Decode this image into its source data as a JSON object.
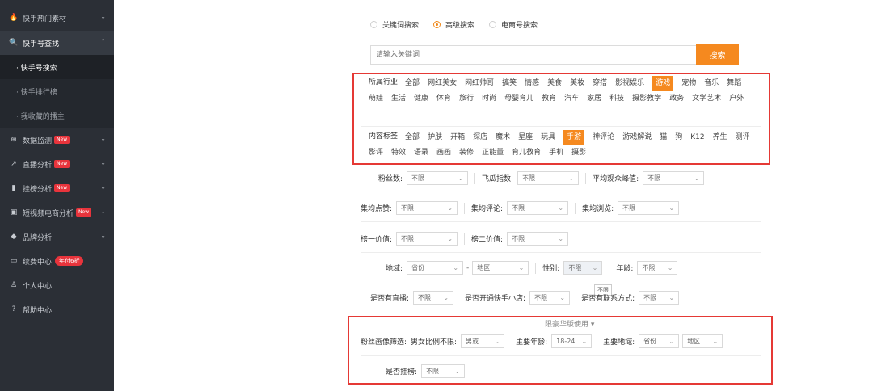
{
  "sidebar": {
    "items": [
      {
        "icon": "flame-icon",
        "glyph": "🔥",
        "label": "快手热门素材",
        "chev": "⌄"
      },
      {
        "icon": "search-icon",
        "glyph": "🔍",
        "label": "快手号查找",
        "chev": "⌃"
      },
      {
        "label": "· 快手号搜索"
      },
      {
        "label": "· 快手排行榜"
      },
      {
        "label": "· 我收藏的播主"
      },
      {
        "icon": "monitor-icon",
        "glyph": "⊕",
        "label": "数据监测",
        "badge": "New",
        "chev": "⌄"
      },
      {
        "icon": "live-chart-icon",
        "glyph": "↗",
        "label": "直播分析",
        "badge": "New",
        "chev": "⌄"
      },
      {
        "icon": "bar-chart-icon",
        "glyph": "▮",
        "label": "挂榜分析",
        "badge": "New",
        "chev": "⌄"
      },
      {
        "icon": "bag-icon",
        "glyph": "▣",
        "label": "短视频电商分析",
        "badge": "New",
        "chev": "⌄"
      },
      {
        "icon": "diamond-icon",
        "glyph": "◆",
        "label": "品牌分析",
        "chev": "⌄"
      },
      {
        "icon": "card-icon",
        "glyph": "▭",
        "label": "续费中心",
        "pill": "年付6折"
      },
      {
        "icon": "user-icon",
        "glyph": "♙",
        "label": "个人中心"
      },
      {
        "icon": "help-icon",
        "glyph": "?",
        "label": "帮助中心"
      }
    ]
  },
  "search": {
    "modes": [
      "关键词搜索",
      "高级搜索",
      "电商号搜索"
    ],
    "placeholder": "请输入关键词",
    "button": "搜索"
  },
  "industry": {
    "label": "所属行业:",
    "tags": [
      "全部",
      "网红美女",
      "网红帅哥",
      "搞笑",
      "情感",
      "美食",
      "美妆",
      "穿搭",
      "影视娱乐",
      "游戏",
      "宠物",
      "音乐",
      "舞蹈",
      "萌娃",
      "生活",
      "健康",
      "体育",
      "旅行",
      "时尚",
      "母婴育儿",
      "教育",
      "汽车",
      "家居",
      "科技",
      "摄影教学",
      "政务",
      "文学艺术",
      "户外"
    ]
  },
  "content": {
    "label": "内容标签:",
    "tags": [
      "全部",
      "护肤",
      "开箱",
      "探店",
      "魔术",
      "星座",
      "玩具",
      "手游",
      "神评论",
      "游戏解说",
      "猫",
      "狗",
      "K12",
      "养生",
      "测评",
      "影评",
      "特效",
      "语录",
      "画画",
      "装修",
      "正能量",
      "育儿教育",
      "手机",
      "摄影"
    ]
  },
  "filters": {
    "fans": {
      "label": "粉丝数:",
      "value": "不限"
    },
    "feigua": {
      "label": "飞瓜指数:",
      "value": "不限"
    },
    "avg_peak": {
      "label": "平均观众峰值:",
      "value": "不限"
    },
    "avg_like": {
      "label": "集均点赞:",
      "value": "不限"
    },
    "avg_comment": {
      "label": "集均评论:",
      "value": "不限"
    },
    "avg_view": {
      "label": "集均浏览:",
      "value": "不限"
    },
    "rank1": {
      "label": "榜一价值:",
      "value": "不限"
    },
    "rank2": {
      "label": "榜二价值:",
      "value": "不限"
    },
    "region": {
      "label": "地域:",
      "province": "省份",
      "dash": "-",
      "district": "地区"
    },
    "gender": {
      "label": "性别:",
      "value": "不限"
    },
    "age": {
      "label": "年龄:",
      "value": "不限"
    },
    "live": {
      "label": "是否有直播:",
      "value": "不限"
    },
    "shop": {
      "label": "是否开通快手小店:",
      "value": "不限"
    },
    "contact": {
      "label": "是否有联系方式:",
      "value": "不限"
    },
    "tooltip": "不限"
  },
  "premium": {
    "note": "限豪华版使用 ▾",
    "fan_profile": "粉丝画像筛选:",
    "ratio_label": "男女比例不限:",
    "ratio_value": "男或...",
    "age_label": "主要年龄:",
    "age_value": "18-24",
    "region_label": "主要地域:",
    "province": "省份",
    "district": "地区",
    "rank_label": "是否挂榜:",
    "rank_value": "不限"
  },
  "colors": {
    "accent": "#f5891f",
    "highlight_box": "#e53935",
    "sidebar_bg": "#2b2f36"
  }
}
